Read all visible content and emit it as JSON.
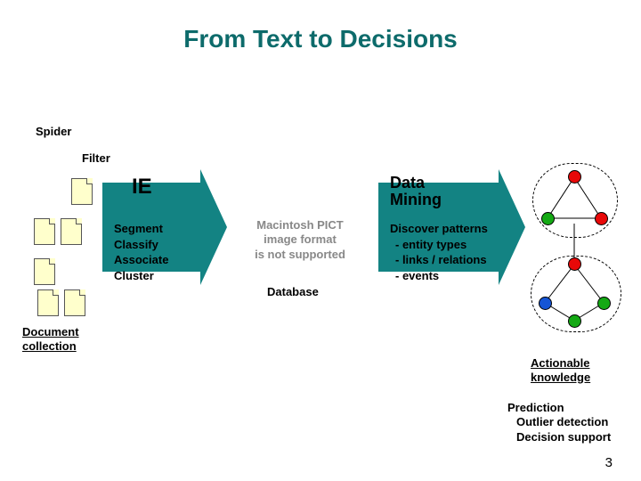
{
  "title": "From Text to Decisions",
  "labels": {
    "spider": "Spider",
    "filter": "Filter",
    "database": "Database"
  },
  "ie": {
    "heading": "IE",
    "segment": "Segment",
    "classify": "Classify",
    "associate": "Associate",
    "cluster": "Cluster"
  },
  "dm": {
    "heading_line1": "Data",
    "heading_line2": "Mining",
    "discover": "Discover patterns",
    "b1": "- entity types",
    "b2": "- links / relations",
    "b3": "- events"
  },
  "pict": {
    "l1": "Macintosh PICT",
    "l2": "image format",
    "l3": "is not supported"
  },
  "doc_collection": {
    "l1": "Document",
    "l2": "collection"
  },
  "actionable": {
    "l1": "Actionable",
    "l2": "knowledge"
  },
  "outcomes": {
    "l1": "Prediction",
    "l2": "Outlier detection",
    "l3": "Decision support"
  },
  "slide_number": "3"
}
